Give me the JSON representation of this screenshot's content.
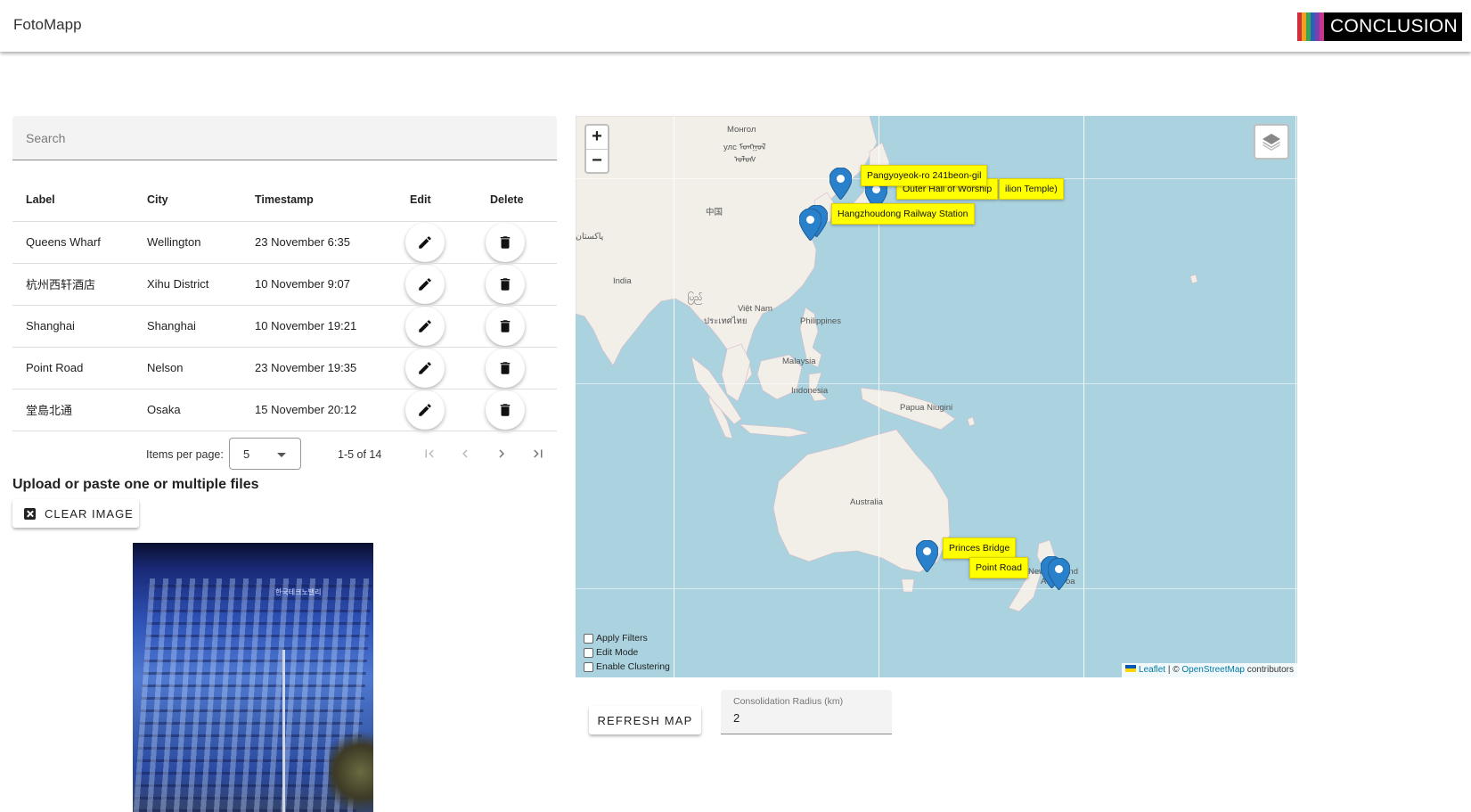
{
  "app": {
    "title": "FotoMapp",
    "logo_text": "CONCLUSION",
    "logo_bar_colors": [
      "#d12e3b",
      "#f0a21c",
      "#3aa655",
      "#2a63b6",
      "#7a3fb0",
      "#c8358f"
    ]
  },
  "search": {
    "placeholder": "Search",
    "value": ""
  },
  "table": {
    "headers": {
      "label": "Label",
      "city": "City",
      "timestamp": "Timestamp",
      "edit": "Edit",
      "delete": "Delete"
    },
    "rows": [
      {
        "label": "Queens Wharf",
        "city": "Wellington",
        "timestamp": "23 November 6:35"
      },
      {
        "label": "杭州西轩酒店",
        "city": "Xihu District",
        "timestamp": "10 November 9:07"
      },
      {
        "label": "Shanghai",
        "city": "Shanghai",
        "timestamp": "10 November 19:21"
      },
      {
        "label": "Point Road",
        "city": "Nelson",
        "timestamp": "23 November 19:35"
      },
      {
        "label": "堂島北通",
        "city": "Osaka",
        "timestamp": "15 November 20:12"
      }
    ]
  },
  "paginator": {
    "items_per_page_label": "Items per page:",
    "page_size": "5",
    "range": "1-5 of 14"
  },
  "upload": {
    "title": "Upload or paste one or multiple files",
    "clear_label": "CLEAR IMAGE",
    "photo_sign": "한국테크노밸리"
  },
  "map": {
    "zoom_in": "+",
    "zoom_out": "−",
    "places": [
      "Монгол",
      "улс ᠮᠣᠩᠭᠣᠯ",
      "中国",
      "India",
      "Việt Nam",
      "ประเทศไทย",
      "Philippines",
      "Malaysia",
      "Indonesia",
      "Papua Niugini",
      "Australia",
      "New Zealand",
      "Aotearoa",
      "ᠤᠯᠤᠰ",
      "ပြည်",
      "پاکستان"
    ],
    "tooltips": [
      "Pangyoyeok-ro 241beon-gil",
      "Outer Hall of Worship",
      "ilion Temple)",
      "Hangzhoudong Railway Station",
      "Princes Bridge",
      "Point Road"
    ],
    "options": {
      "apply_filters": "Apply Filters",
      "edit_mode": "Edit Mode",
      "enable_clustering": "Enable Clustering"
    },
    "attribution": {
      "leaflet": "Leaflet",
      "sep": " | © ",
      "osm": "OpenStreetMap",
      "contributors": " contributors"
    },
    "land_color": "#f2efe9",
    "water_color": "#aad3df",
    "marker_color": "#2a81cb",
    "tooltip_color": "#ffff00"
  },
  "controls": {
    "refresh_label": "REFRESH MAP",
    "radius_label": "Consolidation Radius (km)",
    "radius_value": "2"
  }
}
